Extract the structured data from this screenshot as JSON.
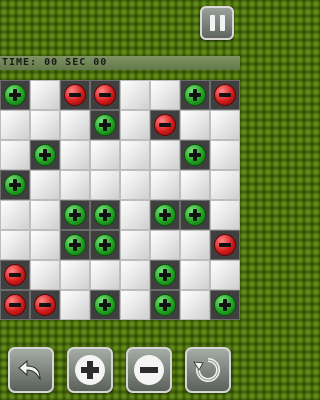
{
  "timer": {
    "text": "TIME: 00 SEC 00"
  },
  "board": {
    "rows": [
      [
        "plus",
        "empty",
        "minus",
        "minus",
        "empty",
        "empty",
        "plus",
        "minus"
      ],
      [
        "empty",
        "empty",
        "empty",
        "plus",
        "empty",
        "minus",
        "empty",
        "empty"
      ],
      [
        "empty",
        "plus",
        "empty",
        "empty",
        "empty",
        "empty",
        "plus",
        "empty"
      ],
      [
        "plus",
        "empty",
        "empty",
        "empty",
        "empty",
        "empty",
        "empty",
        "empty"
      ],
      [
        "empty",
        "empty",
        "plus",
        "plus",
        "empty",
        "plus",
        "plus",
        "empty"
      ],
      [
        "empty",
        "empty",
        "plus",
        "plus",
        "empty",
        "empty",
        "empty",
        "minus"
      ],
      [
        "minus",
        "empty",
        "empty",
        "empty",
        "empty",
        "plus",
        "empty",
        "empty"
      ],
      [
        "minus",
        "minus",
        "empty",
        "plus",
        "empty",
        "plus",
        "empty",
        "plus"
      ]
    ]
  },
  "controls": {
    "pause": {
      "icon": "pause-icon"
    },
    "undo": {
      "icon": "undo-arrow-icon"
    },
    "plus": {
      "icon": "plus-icon"
    },
    "minus": {
      "icon": "minus-icon"
    },
    "restart": {
      "icon": "restart-icon"
    }
  },
  "colors": {
    "plus_token": "#22a322",
    "minus_token": "#d31b1b",
    "filled_cell": "#3f3f3f",
    "empty_cell": "#e6e6e6",
    "background": "#3a5a0c"
  }
}
